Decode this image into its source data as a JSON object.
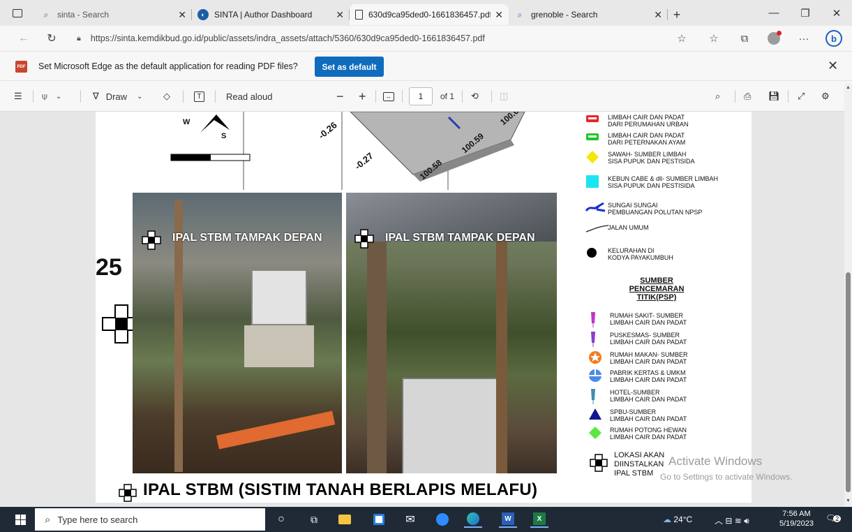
{
  "tabs": [
    {
      "label": "sinta - Search",
      "icon": "search-icon"
    },
    {
      "label": "SINTA | Author Dashboard",
      "icon": "sinta-logo-icon"
    },
    {
      "label": "630d9ca95ded0-1661836457.pdf",
      "icon": "document-icon",
      "active": true
    },
    {
      "label": "grenoble - Search",
      "icon": "search-icon"
    }
  ],
  "address": {
    "url": "https://sinta.kemdikbud.go.id/public/assets/indra_assets/attach/5360/630d9ca95ded0-1661836457.pdf"
  },
  "infobar": {
    "message": "Set Microsoft Edge as the default application for reading PDF files?",
    "button": "Set as default",
    "badge": "PDF"
  },
  "pdf_toolbar": {
    "draw": "Draw",
    "read_aloud": "Read aloud",
    "minus": "−",
    "plus": "+",
    "page": "1",
    "of": "of 1"
  },
  "document": {
    "map_labels": {
      "w": "W",
      "s": "S",
      "v1": "-0.26",
      "v2": "-0.27",
      "v3": "100.58",
      "v4": "100.59",
      "v5": "100.6",
      "num": "25"
    },
    "photo_left_label": "IPAL STBM TAMPAK DEPAN",
    "photo_right_label": "IPAL STBM TAMPAK DEPAN",
    "caption": "IPAL STBM (SISTIM TANAH BERLAPIS MELAFU)",
    "legend_top": [
      {
        "line1": "LIMBAH CAIR DAN PADAT",
        "line2": "DARI PERUMAHAN URBAN",
        "color": "#e8262a",
        "symbol": "bus"
      },
      {
        "line1": "LIMBAH CAIR DAN PADAT",
        "line2": "DARI PETERNAKAN AYAM",
        "color": "#1fc62a",
        "symbol": "bus"
      },
      {
        "line1": "SAWAH- SUMBER LIMBAH",
        "line2": "SISA PUPUK DAN PESTISIDA",
        "color": "#f5e600",
        "symbol": "diamond"
      },
      {
        "line1": "KEBUN CABE & dll- SUMBER LIMBAH",
        "line2": "SISA PUPUK DAN PESTISIDA",
        "color": "#19e6f0",
        "symbol": "square"
      },
      {
        "line1": "SUNGAI SUNGAI",
        "line2": "PEMBUANGAN POLUTAN NPSP",
        "color": "#1b2fd0",
        "symbol": "river"
      },
      {
        "line1": "JALAN UMUM",
        "line2": "",
        "color": "#222222",
        "symbol": "road"
      },
      {
        "line1": "KELURAHAN DI",
        "line2": "KODYA PAYAKUMBUH",
        "color": "#000000",
        "symbol": "dot"
      }
    ],
    "psp_title": [
      "SUMBER",
      "PENCEMARAN",
      "TITIK(PSP)"
    ],
    "legend_psp": [
      {
        "line1": "RUMAH SAKIT- SUMBER",
        "line2": "LIMBAH CAIR DAN PADAT",
        "color": "#c232c8",
        "symbol": "pin"
      },
      {
        "line1": "PUSKESMAS- SUMBER",
        "line2": "LIMBAH CAIR DAN PADAT",
        "color": "#8a3fc8",
        "symbol": "pin"
      },
      {
        "line1": "RUMAH MAKAN- SUMBER",
        "line2": "LIMBAH CAIR DAN PADAT",
        "color": "#f07b22",
        "symbol": "star"
      },
      {
        "line1": "PABRIK KERTAS & UMKM",
        "line2": "LIMBAH CAIR DAN PADAT",
        "color": "#4a8be8",
        "symbol": "circle"
      },
      {
        "line1": "HOTEL-SUMBER",
        "line2": "LIMBAH CAIR DAN PADAT",
        "color": "#3d8fb0",
        "symbol": "pin"
      },
      {
        "line1": "SPBU-SUMBER",
        "line2": "LIMBAH CAIR DAN PADAT",
        "color": "#13168f",
        "symbol": "triangle"
      },
      {
        "line1": "RUMAH POTONG HEWAN",
        "line2": "LIMBAH CAIR DAN PADAT",
        "color": "#5ce640",
        "symbol": "diamond"
      }
    ],
    "lokasi": [
      "LOKASI AKAN",
      "DIINSTALKAN",
      "IPAL STBM"
    ]
  },
  "watermark": {
    "title": "Activate Windows",
    "sub": "Go to Settings to activate Windows."
  },
  "taskbar": {
    "search_placeholder": "Type here to search",
    "temp": "24°C",
    "time": "7:56 AM",
    "date": "5/19/2023",
    "notif_count": "2"
  }
}
